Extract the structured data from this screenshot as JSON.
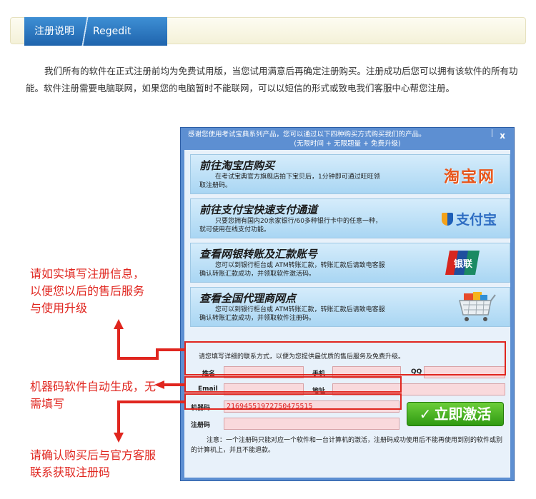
{
  "header": {
    "title_zh": "注册说明",
    "title_en": "Regedit"
  },
  "intro": "我们所有的软件在正式注册前均为免费试用版，当您试用满意后再确定注册购买。注册成功后您可以拥有该软件的所有功能。软件注册需要电脑联网，如果您的电脑暂时不能联网，可以以短信的形式或致电我们客服中心帮您注册。",
  "dialog": {
    "title_line1": "感谢您使用考试宝典系列产品，您可以通过以下四种购买方式购买我们的产品。",
    "title_line2": "(无限时间 + 无限题量 + 免费升级)",
    "close_label": "x",
    "cards": [
      {
        "title": "前往淘宝店购买",
        "desc": "在考试宝典官方旗舰店拍下宝贝后，1分钟即可通过旺旺领取注册码。",
        "logo": "淘宝网"
      },
      {
        "title": "前往支付宝快速支付通道",
        "desc": "只要您拥有国内20余家银行/60多种银行卡中的任意一种，就可使用在线支付功能。",
        "logo": "支付宝"
      },
      {
        "title": "查看网银转账及汇款账号",
        "desc": "您可以到银行柜台或 ATM转账汇款，转账汇款后请致电客服确认转账汇款成功，并领取软件激活码。",
        "logo": "银联"
      },
      {
        "title": "查看全国代理商网点",
        "desc": "您可以到银行柜台或 ATM转账汇款，转账汇款后请致电客服确认转账汇款成功，并领取软件注册码。",
        "logo": ""
      }
    ],
    "contact_label": "请您填写详细的联系方式，以便为您提供最优质的售后服务及免费升级。",
    "fields": {
      "name": "姓名",
      "phone": "手机",
      "qq": "QQ",
      "email": "Email",
      "address": "地址",
      "machine_code": "机器码",
      "machine_code_value": "216945519727504755​15",
      "reg_code": "注册码"
    },
    "activate_label": "立即激活",
    "notice": "注意：一个注册码只能对应一个软件和一台计算机的激活，注册码成功使用后不能再使用到别的软件或别的计算机上，并且不能退款。"
  },
  "annotations": {
    "contact": "请如实填写注册信息，以便您以后的售后服务与使用升级",
    "machine": "机器码软件自动生成，无需填写",
    "reg": "请确认购买后与官方客服联系获取注册码"
  },
  "colors": {
    "accent_blue": "#1f64ad",
    "annotation_red": "#e0261f",
    "button_green": "#2f9a12"
  }
}
